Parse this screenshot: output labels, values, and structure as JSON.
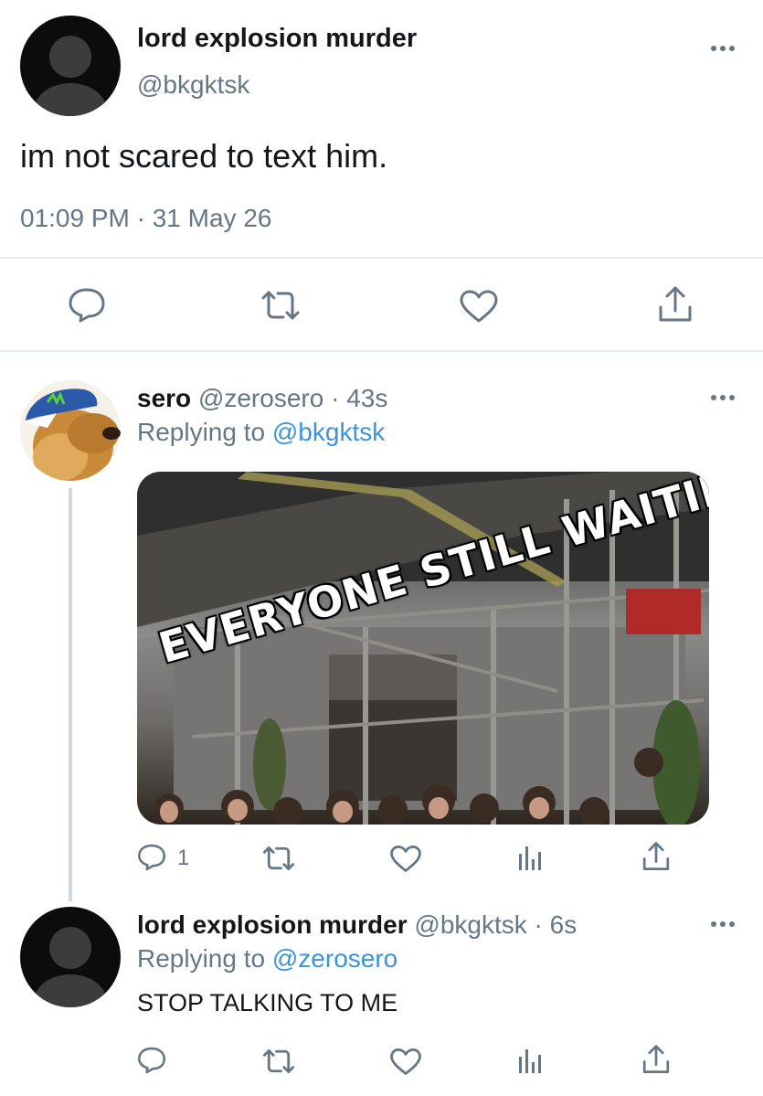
{
  "main_tweet": {
    "display_name": "lord explosion murder",
    "handle": "@bkgktsk",
    "text": "im not scared to text him.",
    "timestamp": "01:09 PM · 31 May 26",
    "actions": [
      "reply-icon",
      "retweet-icon",
      "like-icon",
      "share-icon"
    ]
  },
  "reply_1": {
    "display_name": "sero",
    "handle": "@zerosero",
    "time": "· 43s",
    "replying_prefix": "Replying to",
    "replying_to": "@bkgktsk",
    "media_caption": "EVERYONE STILL WAITING",
    "reply_count": "1",
    "actions": [
      "reply-icon",
      "retweet-icon",
      "like-icon",
      "analytics-icon",
      "share-icon"
    ]
  },
  "reply_2": {
    "display_name": "lord explosion murder",
    "handle": "@bkgktsk",
    "time": "· 6s",
    "replying_prefix": "Replying to",
    "replying_to": "@zerosero",
    "text": "STOP TALKING TO ME",
    "actions": [
      "reply-icon",
      "retweet-icon",
      "like-icon",
      "analytics-icon",
      "share-icon"
    ]
  },
  "colors": {
    "link_blue": "#3b94d9",
    "secondary_gray": "#657786",
    "divider": "#e6ecf0"
  }
}
